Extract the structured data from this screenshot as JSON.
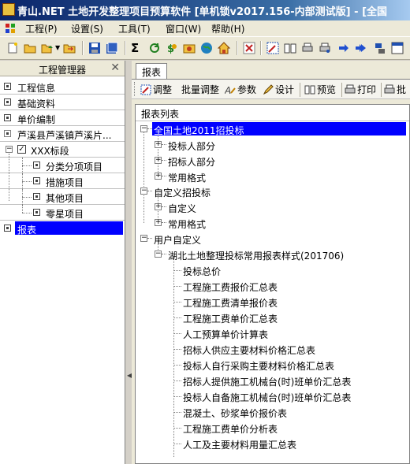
{
  "window": {
    "title": "青山.NET  土地开发整理项目预算软件 [单机锁v2017.156-内部测试版] - [全国"
  },
  "menu": [
    "工程(P)",
    "设置(S)",
    "工具(T)",
    "窗口(W)",
    "帮助(H)"
  ],
  "left_panel": {
    "title": "工程管理器",
    "close_glyph": "✕",
    "items": [
      {
        "label": "工程信息"
      },
      {
        "label": "基础资料"
      },
      {
        "label": "单价编制"
      },
      {
        "label": "芦溪县芦溪镇芦溪片..."
      },
      {
        "label": "XXX标段"
      },
      {
        "label": "分类分项项目"
      },
      {
        "label": "措施项目"
      },
      {
        "label": "其他项目"
      },
      {
        "label": "零星项目"
      },
      {
        "label": "报表"
      }
    ],
    "selected": "报表"
  },
  "tab": {
    "label": "报表"
  },
  "doc_toolbar": {
    "adjust": "调整",
    "batch_adjust": "批量调整",
    "params": "参数",
    "design": "设计",
    "preview": "预览",
    "print": "打印",
    "batch_print": "批"
  },
  "report_panel": {
    "header": "报表列表",
    "tree": [
      {
        "label": "全国土地2011招投标",
        "selected": true
      },
      {
        "label": "投标人部分"
      },
      {
        "label": "招标人部分"
      },
      {
        "label": "常用格式"
      },
      {
        "label": "自定义招投标"
      },
      {
        "label": "自定义"
      },
      {
        "label": "常用格式"
      },
      {
        "label": "用户自定义"
      },
      {
        "label": "湖北土地整理投标常用报表样式(201706)"
      },
      {
        "label": "投标总价"
      },
      {
        "label": "工程施工费报价汇总表"
      },
      {
        "label": "工程施工费清单报价表"
      },
      {
        "label": "工程施工费单价汇总表"
      },
      {
        "label": "人工预算单价计算表"
      },
      {
        "label": "招标人供应主要材料价格汇总表"
      },
      {
        "label": "投标人自行采购主要材料价格汇总表"
      },
      {
        "label": "招标人提供施工机械台(时)班单价汇总表"
      },
      {
        "label": "投标人自备施工机械台(时)班单价汇总表"
      },
      {
        "label": "混凝土、砂浆单价报价表"
      },
      {
        "label": "工程施工费单价分析表"
      },
      {
        "label": "人工及主要材料用量汇总表"
      }
    ]
  },
  "colors": {
    "selection": "#0000ff",
    "title_bar": "#0a246a"
  }
}
